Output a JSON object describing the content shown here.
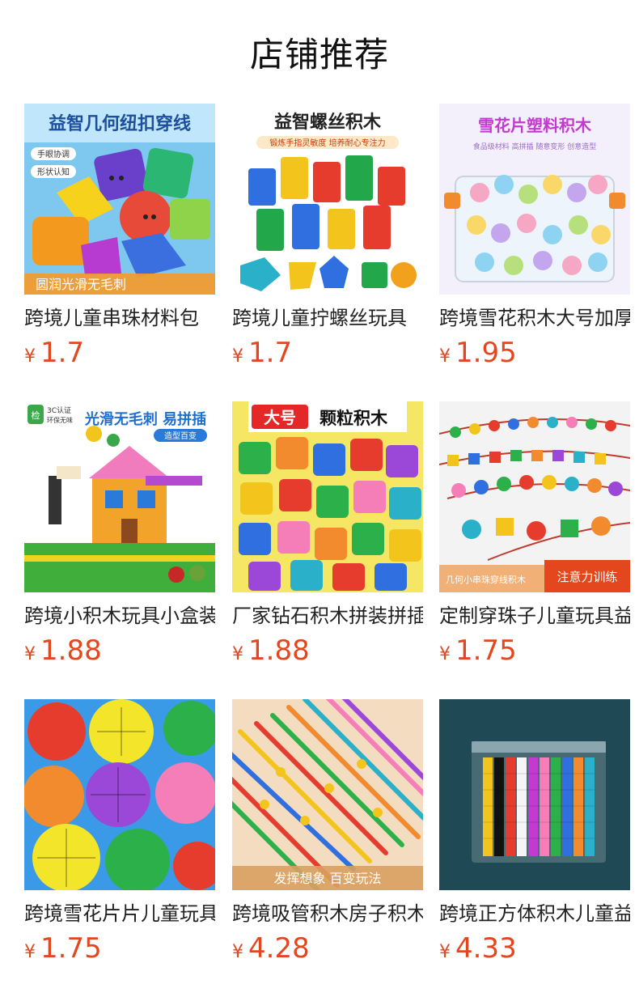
{
  "section_title": "店铺推荐",
  "currency_symbol": "¥",
  "products": [
    {
      "name": "跨境儿童串珠材料包",
      "price": "1.7",
      "image_text": "益智几何纽扣穿线",
      "badges": [
        "手眼协调",
        "形状认知"
      ],
      "banner": "圆润光滑无毛刺"
    },
    {
      "name": "跨境儿童拧螺丝玩具",
      "price": "1.7",
      "image_text": "益智螺丝积木",
      "subtext": "锻炼手指灵敏度 培养耐心专注力"
    },
    {
      "name": "跨境雪花积木大号加厚",
      "price": "1.95",
      "image_text": "雪花片塑料积木",
      "subtext": "食品级材料 高拼插 随意变形 创意造型"
    },
    {
      "name": "跨境小积木玩具小盒装",
      "price": "1.88",
      "image_text": "光滑无毛刺 易拼插",
      "badges": [
        "3C认证",
        "环保无味"
      ],
      "banner": "造型百变",
      "cert_mark": "检"
    },
    {
      "name": "厂家钻石积木拼装拼插",
      "price": "1.88",
      "image_text_a": "大号",
      "image_text_b": "颗粒积木"
    },
    {
      "name": "定制穿珠子儿童玩具益智",
      "price": "1.75",
      "banner_left": "几何小串珠穿线积木",
      "banner_right": "注意力训练"
    },
    {
      "name": "跨境雪花片片儿童玩具",
      "price": "1.75"
    },
    {
      "name": "跨境吸管积木房子积木",
      "price": "4.28",
      "banner": "发挥想象 百变玩法"
    },
    {
      "name": "跨境正方体积木儿童益智",
      "price": "4.33"
    }
  ]
}
